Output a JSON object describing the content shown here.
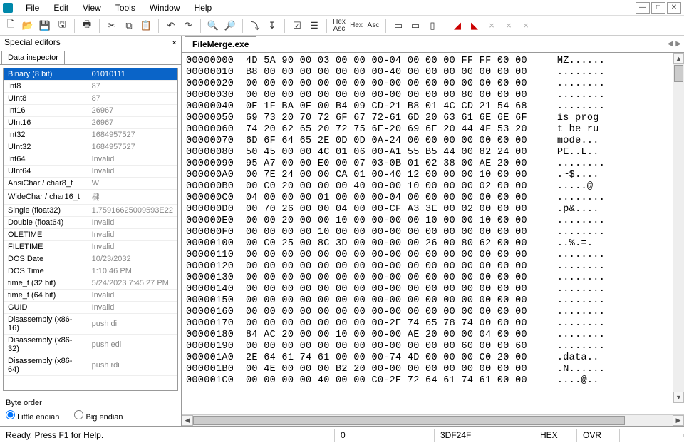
{
  "menu": {
    "items": [
      "File",
      "Edit",
      "View",
      "Tools",
      "Window",
      "Help"
    ]
  },
  "panel": {
    "title": "Special editors",
    "tab": "Data inspector",
    "rows": [
      {
        "k": "Binary (8 bit)",
        "v": "01010111",
        "sel": true
      },
      {
        "k": "Int8",
        "v": "87"
      },
      {
        "k": "UInt8",
        "v": "87"
      },
      {
        "k": "Int16",
        "v": "26967"
      },
      {
        "k": "UInt16",
        "v": "26967"
      },
      {
        "k": "Int32",
        "v": "1684957527"
      },
      {
        "k": "UInt32",
        "v": "1684957527"
      },
      {
        "k": "Int64",
        "v": "Invalid"
      },
      {
        "k": "UInt64",
        "v": "Invalid"
      },
      {
        "k": "AnsiChar / char8_t",
        "v": "W"
      },
      {
        "k": "WideChar / char16_t",
        "v": "楗"
      },
      {
        "k": "Single (float32)",
        "v": "1.75916625009593E22"
      },
      {
        "k": "Double (float64)",
        "v": "Invalid"
      },
      {
        "k": "OLETIME",
        "v": "Invalid"
      },
      {
        "k": "FILETIME",
        "v": "Invalid"
      },
      {
        "k": "DOS Date",
        "v": "10/23/2032"
      },
      {
        "k": "DOS Time",
        "v": "1:10:46 PM"
      },
      {
        "k": "time_t (32 bit)",
        "v": "5/24/2023 7:45:27 PM"
      },
      {
        "k": "time_t (64 bit)",
        "v": "Invalid"
      },
      {
        "k": "GUID",
        "v": "Invalid"
      },
      {
        "k": "Disassembly (x86-16)",
        "v": "push di"
      },
      {
        "k": "Disassembly (x86-32)",
        "v": "push edi"
      },
      {
        "k": "Disassembly (x86-64)",
        "v": "push rdi"
      }
    ],
    "byteorder": {
      "label": "Byte order",
      "little": "Little endian",
      "big": "Big endian"
    }
  },
  "document": {
    "tab": "FileMerge.exe"
  },
  "hex": {
    "rows": [
      {
        "a": "00000000",
        "h": "4D 5A 90 00 03 00 00 00-04 00 00 00 FF FF 00 00",
        "t": "MZ......"
      },
      {
        "a": "00000010",
        "h": "B8 00 00 00 00 00 00 00-40 00 00 00 00 00 00 00",
        "t": "........"
      },
      {
        "a": "00000020",
        "h": "00 00 00 00 00 00 00 00-00 00 00 00 00 00 00 00",
        "t": "........"
      },
      {
        "a": "00000030",
        "h": "00 00 00 00 00 00 00 00-00 00 00 00 80 00 00 00",
        "t": "........"
      },
      {
        "a": "00000040",
        "h": "0E 1F BA 0E 00 B4 09 CD-21 B8 01 4C CD 21 54 68",
        "t": "........"
      },
      {
        "a": "00000050",
        "h": "69 73 20 70 72 6F 67 72-61 6D 20 63 61 6E 6E 6F",
        "t": "is prog"
      },
      {
        "a": "00000060",
        "h": "74 20 62 65 20 72 75 6E-20 69 6E 20 44 4F 53 20",
        "t": "t be ru"
      },
      {
        "a": "00000070",
        "h": "6D 6F 64 65 2E 0D 0D 0A-24 00 00 00 00 00 00 00",
        "t": "mode..."
      },
      {
        "a": "00000080",
        "h": "50 45 00 00 4C 01 06 00-A1 55 B5 44 00 82 24 00",
        "t": "PE..L.."
      },
      {
        "a": "00000090",
        "h": "95 A7 00 00 E0 00 07 03-0B 01 02 38 00 AE 20 00",
        "t": "........"
      },
      {
        "a": "000000A0",
        "h": "00 7E 24 00 00 CA 01 00-40 12 00 00 00 10 00 00",
        "t": ".~$...."
      },
      {
        "a": "000000B0",
        "h": "00 C0 20 00 00 00 40 00-00 10 00 00 00 02 00 00",
        "t": ".....@"
      },
      {
        "a": "000000C0",
        "h": "04 00 00 00 01 00 00 00-04 00 00 00 00 00 00 00",
        "t": "........"
      },
      {
        "a": "000000D0",
        "h": "00 70 26 00 00 04 00 00-CF A3 3E 00 02 00 00 00",
        "t": ".p&...."
      },
      {
        "a": "000000E0",
        "h": "00 00 20 00 00 10 00 00-00 00 10 00 00 10 00 00",
        "t": "........"
      },
      {
        "a": "000000F0",
        "h": "00 00 00 00 10 00 00 00-00 00 00 00 00 00 00 00",
        "t": "........"
      },
      {
        "a": "00000100",
        "h": "00 C0 25 00 8C 3D 00 00-00 00 26 00 80 62 00 00",
        "t": "..%.=."
      },
      {
        "a": "00000110",
        "h": "00 00 00 00 00 00 00 00-00 00 00 00 00 00 00 00",
        "t": "........"
      },
      {
        "a": "00000120",
        "h": "00 00 00 00 00 00 00 00-00 00 00 00 00 00 00 00",
        "t": "........"
      },
      {
        "a": "00000130",
        "h": "00 00 00 00 00 00 00 00-00 00 00 00 00 00 00 00",
        "t": "........"
      },
      {
        "a": "00000140",
        "h": "00 00 00 00 00 00 00 00-00 00 00 00 00 00 00 00",
        "t": "........"
      },
      {
        "a": "00000150",
        "h": "00 00 00 00 00 00 00 00-00 00 00 00 00 00 00 00",
        "t": "........"
      },
      {
        "a": "00000160",
        "h": "00 00 00 00 00 00 00 00-00 00 00 00 00 00 00 00",
        "t": "........"
      },
      {
        "a": "00000170",
        "h": "00 00 00 00 00 00 00 00-2E 74 65 78 74 00 00 00",
        "t": "........"
      },
      {
        "a": "00000180",
        "h": "84 AC 20 00 00 10 00 00-00 AE 20 00 00 04 00 00",
        "t": "........"
      },
      {
        "a": "00000190",
        "h": "00 00 00 00 00 00 00 00-00 00 00 00 60 00 00 60",
        "t": "........"
      },
      {
        "a": "000001A0",
        "h": "2E 64 61 74 61 00 00 00-74 4D 00 00 00 C0 20 00",
        "t": ".data.."
      },
      {
        "a": "000001B0",
        "h": "00 4E 00 00 00 B2 20 00-00 00 00 00 00 00 00 00",
        "t": ".N......"
      },
      {
        "a": "000001C0",
        "h": "00 00 00 00 40 00 00 C0-2E 72 64 61 74 61 00 00",
        "t": "....@.."
      }
    ]
  },
  "status": {
    "msg": "Ready.  Press F1 for Help.",
    "pos": "0",
    "size": "3DF24F",
    "mode1": "HEX",
    "mode2": "OVR"
  }
}
